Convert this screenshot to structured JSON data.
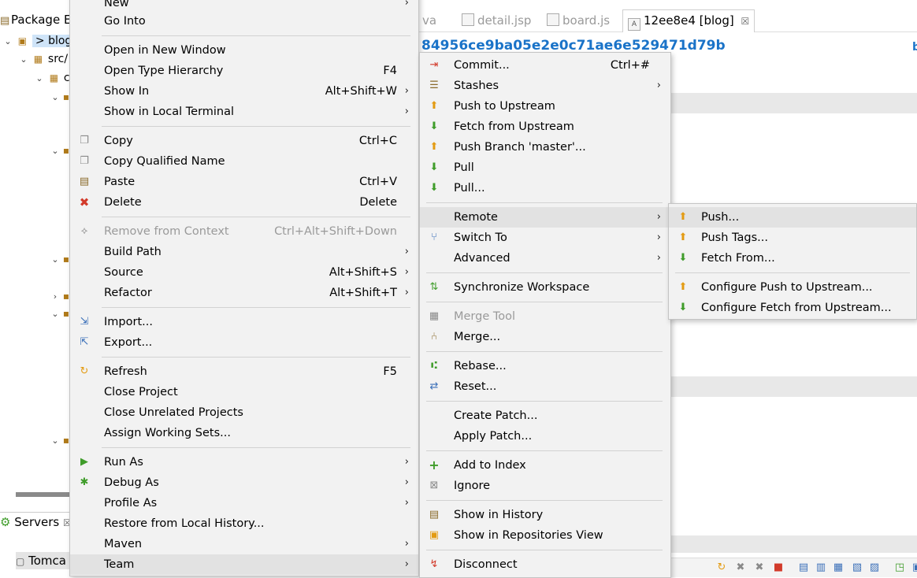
{
  "package_explorer": {
    "tab_label": "Package E",
    "tree": [
      {
        "label": "> blog",
        "chevron": "v",
        "selected": true
      },
      {
        "label": "src/",
        "chevron": "v"
      },
      {
        "label": "c",
        "chevron": "v"
      }
    ],
    "servers_label": "Servers",
    "tomcat_label": "Tomca"
  },
  "editor": {
    "tabs": [
      {
        "label": "va",
        "active": false
      },
      {
        "label": "detail.jsp",
        "active": false
      },
      {
        "label": "board.js",
        "active": false
      },
      {
        "label": "12ee8e4 [blog]",
        "active": true
      }
    ],
    "tab_close": "☒",
    "commit_hash": "84956ce9ba05e2e0c71ae6e529471d79b",
    "edge_link": "b"
  },
  "context_menu": {
    "items": [
      {
        "label": "New",
        "arrow": true
      },
      {
        "label": "Go Into"
      },
      {
        "separator": true
      },
      {
        "label": "Open in New Window"
      },
      {
        "label": "Open Type Hierarchy",
        "shortcut": "F4"
      },
      {
        "label": "Show In",
        "shortcut": "Alt+Shift+W",
        "arrow": true
      },
      {
        "label": "Show in Local Terminal",
        "arrow": true
      },
      {
        "separator": true
      },
      {
        "label": "Copy",
        "shortcut": "Ctrl+C",
        "icon": "copy-icon"
      },
      {
        "label": "Copy Qualified Name",
        "icon": "copy-qualified-name-icon"
      },
      {
        "label": "Paste",
        "shortcut": "Ctrl+V",
        "icon": "paste-icon"
      },
      {
        "label": "Delete",
        "shortcut": "Delete",
        "icon": "delete-icon"
      },
      {
        "separator": true
      },
      {
        "label": "Remove from Context",
        "shortcut": "Ctrl+Alt+Shift+Down",
        "disabled": true,
        "icon": "remove-context-icon"
      },
      {
        "label": "Build Path",
        "arrow": true
      },
      {
        "label": "Source",
        "shortcut": "Alt+Shift+S",
        "arrow": true
      },
      {
        "label": "Refactor",
        "shortcut": "Alt+Shift+T",
        "arrow": true
      },
      {
        "separator": true
      },
      {
        "label": "Import...",
        "icon": "import-icon"
      },
      {
        "label": "Export...",
        "icon": "export-icon"
      },
      {
        "separator": true
      },
      {
        "label": "Refresh",
        "shortcut": "F5",
        "icon": "refresh-icon"
      },
      {
        "label": "Close Project"
      },
      {
        "label": "Close Unrelated Projects"
      },
      {
        "label": "Assign Working Sets..."
      },
      {
        "separator": true
      },
      {
        "label": "Run As",
        "arrow": true,
        "icon": "run-icon"
      },
      {
        "label": "Debug As",
        "arrow": true,
        "icon": "debug-icon"
      },
      {
        "label": "Profile As",
        "arrow": true
      },
      {
        "label": "Restore from Local History..."
      },
      {
        "label": "Maven",
        "arrow": true
      },
      {
        "label": "Team",
        "arrow": true,
        "highlighted": true
      }
    ]
  },
  "team_menu": {
    "items": [
      {
        "label": "Commit...",
        "shortcut": "Ctrl+#",
        "icon": "commit-icon"
      },
      {
        "label": "Stashes",
        "arrow": true,
        "icon": "stashes-icon"
      },
      {
        "label": "Push to Upstream",
        "icon": "push-upstream-icon"
      },
      {
        "label": "Fetch from Upstream",
        "icon": "fetch-upstream-icon"
      },
      {
        "label": "Push Branch 'master'...",
        "icon": "push-branch-icon"
      },
      {
        "label": "Pull",
        "icon": "pull-icon"
      },
      {
        "label": "Pull...",
        "icon": "pull-dialog-icon"
      },
      {
        "separator": true
      },
      {
        "label": "Remote",
        "arrow": true,
        "highlighted": true
      },
      {
        "label": "Switch To",
        "arrow": true,
        "icon": "switch-branch-icon"
      },
      {
        "label": "Advanced",
        "arrow": true
      },
      {
        "separator": true
      },
      {
        "label": "Synchronize Workspace",
        "icon": "synchronize-icon"
      },
      {
        "separator": true
      },
      {
        "label": "Merge Tool",
        "disabled": true,
        "icon": "merge-tool-icon"
      },
      {
        "label": "Merge...",
        "icon": "merge-icon"
      },
      {
        "separator": true
      },
      {
        "label": "Rebase...",
        "icon": "rebase-icon"
      },
      {
        "label": "Reset...",
        "icon": "reset-icon"
      },
      {
        "separator": true
      },
      {
        "label": "Create Patch..."
      },
      {
        "label": "Apply Patch..."
      },
      {
        "separator": true
      },
      {
        "label": "Add to Index",
        "icon": "add-index-icon"
      },
      {
        "label": "Ignore",
        "icon": "ignore-icon"
      },
      {
        "separator": true
      },
      {
        "label": "Show in History",
        "icon": "history-icon"
      },
      {
        "label": "Show in Repositories View",
        "icon": "repositories-icon"
      },
      {
        "separator": true
      },
      {
        "label": "Disconnect",
        "icon": "disconnect-icon"
      }
    ]
  },
  "remote_menu": {
    "items": [
      {
        "label": "Push...",
        "icon": "push-icon",
        "highlighted": true
      },
      {
        "label": "Push Tags...",
        "icon": "push-tags-icon"
      },
      {
        "label": "Fetch From...",
        "icon": "fetch-icon"
      },
      {
        "separator": true
      },
      {
        "label": "Configure Push to Upstream...",
        "icon": "configure-push-icon"
      },
      {
        "label": "Configure Fetch from Upstream...",
        "icon": "configure-fetch-icon"
      }
    ]
  },
  "glyphs": {
    "arrow": "›",
    "chevron_down": "⌄",
    "chevron_right": "›"
  }
}
